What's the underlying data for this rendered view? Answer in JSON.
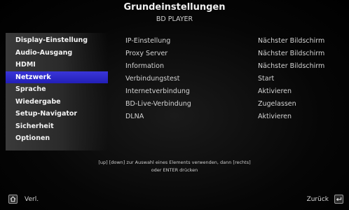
{
  "header": {
    "title": "Grundeinstellungen",
    "subtitle": "BD PLAYER"
  },
  "sidebar": {
    "items": [
      {
        "label": "Display-Einstellung"
      },
      {
        "label": "Audio-Ausgang"
      },
      {
        "label": "HDMI"
      },
      {
        "label": "Netzwerk"
      },
      {
        "label": "Sprache"
      },
      {
        "label": "Wiedergabe"
      },
      {
        "label": "Setup-Navigator"
      },
      {
        "label": "Sicherheit"
      },
      {
        "label": "Optionen"
      }
    ],
    "selected": "Netzwerk",
    "selected_color": "#2f2bd0"
  },
  "settings": [
    {
      "label": "IP-Einstellung",
      "value": "Nächster Bildschirm"
    },
    {
      "label": "Proxy Server",
      "value": "Nächster Bildschirm"
    },
    {
      "label": "Information",
      "value": "Nächster Bildschirm"
    },
    {
      "label": "Verbindungstest",
      "value": "Start"
    },
    {
      "label": "Internetverbindung",
      "value": "Aktivieren"
    },
    {
      "label": "BD-Live-Verbindung",
      "value": "Zugelassen"
    },
    {
      "label": "DLNA",
      "value": "Aktivieren"
    }
  ],
  "hint": {
    "line1": "[up] [down] zur Auswahl eines Elements verwenden, dann [rechts]",
    "line2": "oder ENTER drücken"
  },
  "footer": {
    "exit_label": "Verl.",
    "exit_icon": "home-icon",
    "back_label": "Zurück",
    "back_icon": "return-icon"
  }
}
